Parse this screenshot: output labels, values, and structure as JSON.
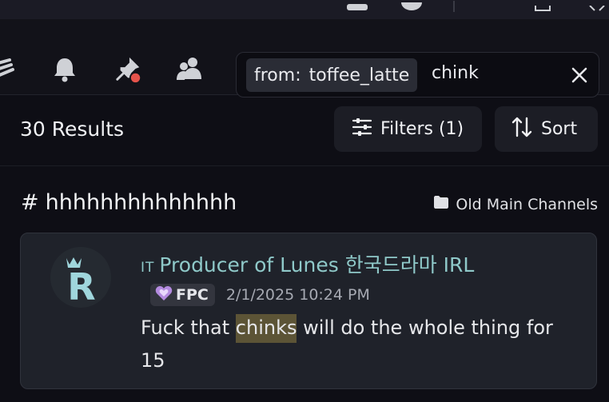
{
  "toolbar": {
    "icons": [
      "threads-icon",
      "bell-icon",
      "pin-icon",
      "members-icon"
    ]
  },
  "search": {
    "filter_key": "from:",
    "filter_value": "toffee_latte",
    "query": "chink"
  },
  "results": {
    "count_label": "30 Results",
    "filters_label": "Filters (1)",
    "sort_label": "Sort"
  },
  "channel": {
    "hash": "#",
    "name": "hhhhhhhhhhhhhh",
    "category": "Old Main Channels"
  },
  "message": {
    "author_prefix": "IT",
    "author_name": "Producer of Lunes 한국드라마 IRL",
    "tag": "FPC",
    "timestamp": "2/1/2025 10:24 PM",
    "text_before": "Fuck that ",
    "text_highlight": "chinks",
    "text_after": " will do the whole thing for 15",
    "avatar_letter": "R"
  },
  "colors": {
    "author": "#8fc9c9",
    "highlight": "#5c5436",
    "alert_dot": "#e5534b"
  }
}
